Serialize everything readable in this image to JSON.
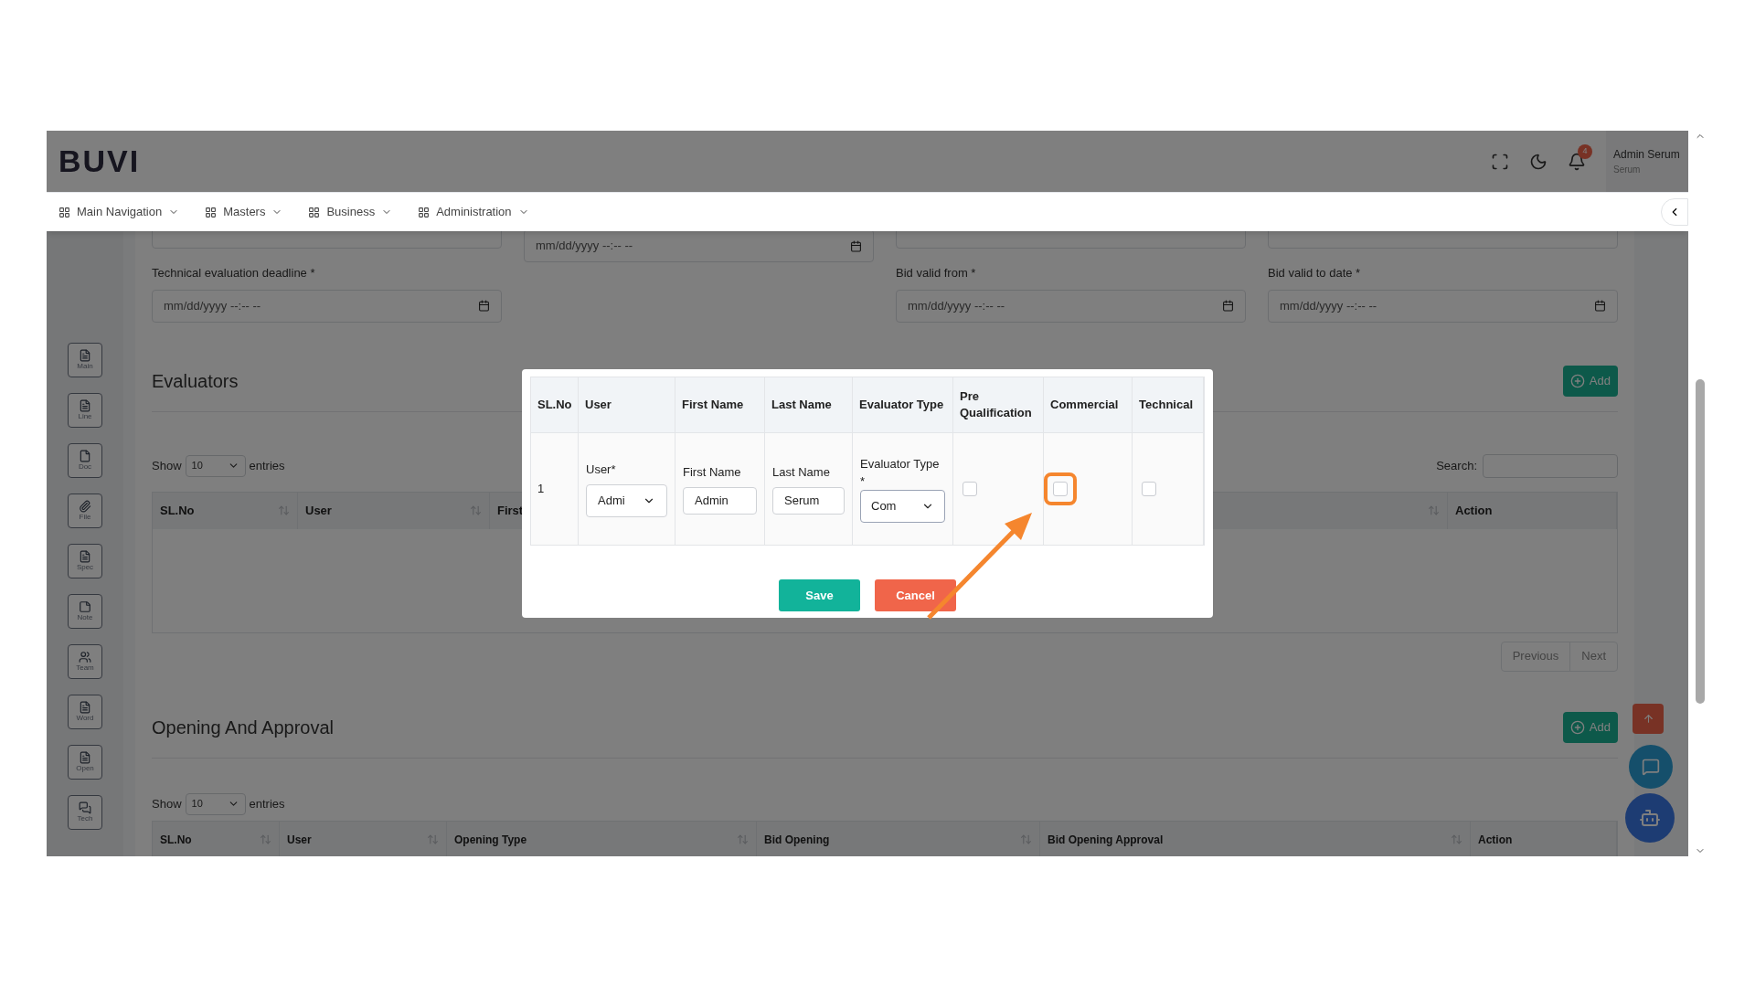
{
  "header": {
    "logo": "BUVI",
    "notification_count": "4",
    "user_name": "Admin Serum",
    "user_role": "Serum"
  },
  "nav": [
    {
      "label": "Main Navigation"
    },
    {
      "label": "Masters"
    },
    {
      "label": "Business"
    },
    {
      "label": "Administration"
    }
  ],
  "sidebar": [
    {
      "label": "Main"
    },
    {
      "label": "Line"
    },
    {
      "label": "Doc"
    },
    {
      "label": "File"
    },
    {
      "label": "Spec"
    },
    {
      "label": "Note"
    },
    {
      "label": "Team"
    },
    {
      "label": "Word"
    },
    {
      "label": "Open"
    },
    {
      "label": "Tech"
    }
  ],
  "form": {
    "top_row": [
      {
        "kind": "cut"
      },
      {
        "kind": "date",
        "placeholder": "mm/dd/yyyy --:-- --"
      },
      {
        "kind": "cut"
      },
      {
        "kind": "cut"
      }
    ],
    "fields": [
      {
        "label": "Technical evaluation deadline *",
        "placeholder": "mm/dd/yyyy --:-- --"
      },
      {
        "label": "Bid valid from *",
        "placeholder": "mm/dd/yyyy --:-- --"
      },
      {
        "label": "Bid valid to date *",
        "placeholder": "mm/dd/yyyy --:-- --"
      }
    ]
  },
  "evaluators": {
    "title": "Evaluators",
    "add_label": "Add",
    "show_label": "Show",
    "entries_value": "10",
    "entries_label": "entries",
    "search_label": "Search:",
    "columns": [
      {
        "label": "SL.No",
        "sortable": true
      },
      {
        "label": "User",
        "sortable": true
      },
      {
        "label": "First",
        "sortable": true
      },
      {
        "label": "Action",
        "sortable": false
      }
    ],
    "pagination": [
      "Previous",
      "Next"
    ]
  },
  "opening": {
    "title": "Opening And Approval",
    "add_label": "Add",
    "show_label": "Show",
    "entries_value": "10",
    "entries_label": "entries",
    "columns": [
      {
        "label": "SL.No",
        "sortable": true
      },
      {
        "label": "User",
        "sortable": true
      },
      {
        "label": "Opening Type",
        "sortable": true
      },
      {
        "label": "Bid Opening",
        "sortable": true
      },
      {
        "label": "Bid Opening Approval",
        "sortable": true
      },
      {
        "label": "Action",
        "sortable": false
      }
    ]
  },
  "modal": {
    "columns": [
      "SL.No",
      "User",
      "First Name",
      "Last Name",
      "Evaluator Type",
      "Pre Qualification",
      "Commercial",
      "Technical"
    ],
    "row": {
      "sl_no": "1",
      "user": {
        "label": "User*",
        "value": "Admi"
      },
      "first_name": {
        "label": "First Name",
        "value": "Admin"
      },
      "last_name": {
        "label": "Last Name",
        "value": "Serum"
      },
      "evaluator_type": {
        "label": "Evaluator Type",
        "required_mark": "*",
        "value": "Com"
      },
      "pre_qualification": {
        "checked": false,
        "highlighted": false
      },
      "commercial": {
        "checked": false,
        "highlighted": true
      },
      "technical": {
        "checked": false,
        "highlighted": false
      }
    },
    "buttons": [
      {
        "label": "Save",
        "kind": "primary"
      },
      {
        "label": "Cancel",
        "kind": "danger"
      }
    ]
  }
}
